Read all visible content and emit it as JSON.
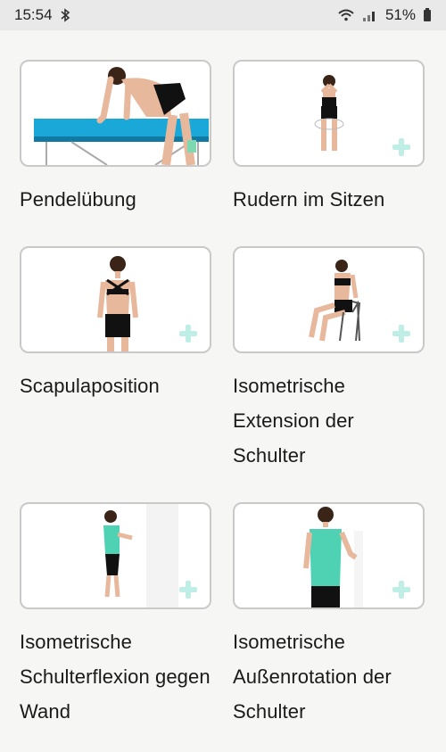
{
  "status": {
    "time": "15:54",
    "battery": "51%",
    "icons": [
      "bluetooth-icon",
      "wifi-icon",
      "signal-icon",
      "battery-icon"
    ]
  },
  "exercises": [
    {
      "title": "Pendelübung",
      "image": "exercise-pendulum-image"
    },
    {
      "title": "Rudern im Sitzen",
      "image": "exercise-seated-rowing-image"
    },
    {
      "title": "Scapulaposition",
      "image": "exercise-scapula-image"
    },
    {
      "title": "Isometrische Extension der Schulter",
      "image": "exercise-iso-extension-image"
    },
    {
      "title": "Isometrische Schulterflexion gegen Wand",
      "image": "exercise-iso-flexion-image"
    },
    {
      "title": "Isometrische Außenrotation der Schulter",
      "image": "exercise-iso-rotation-image"
    }
  ]
}
